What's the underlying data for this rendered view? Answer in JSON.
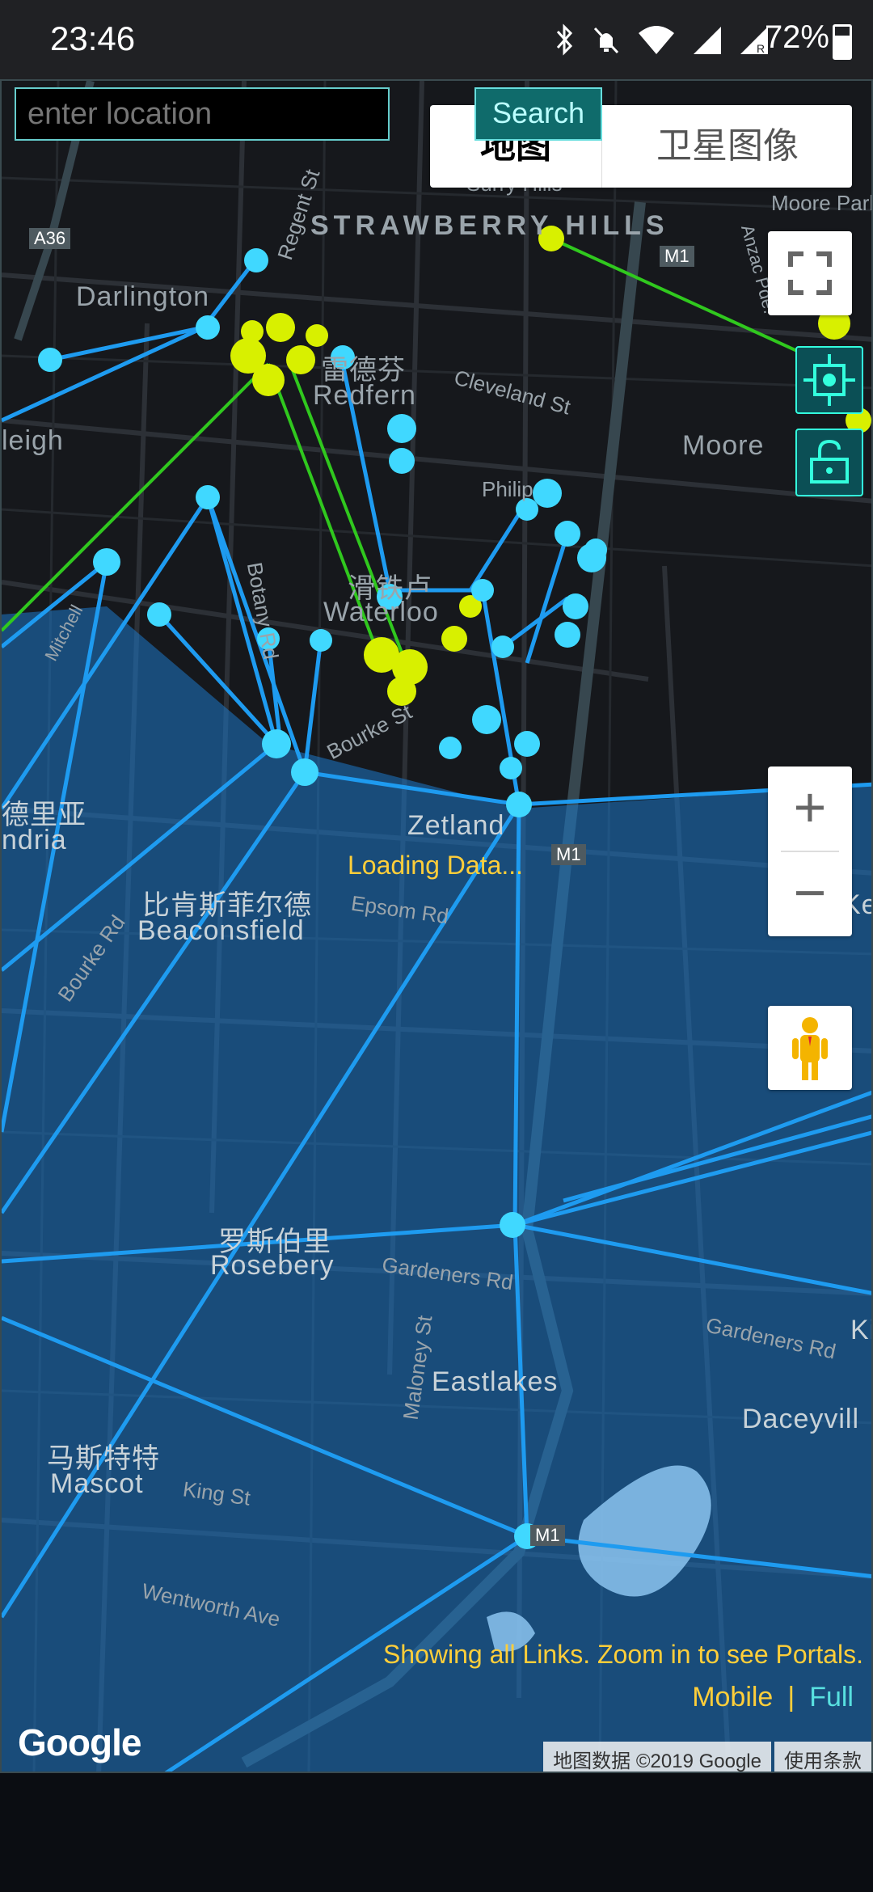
{
  "status_bar": {
    "time": "23:46",
    "battery_percent": "72%",
    "battery_level": 0.72,
    "icons": [
      "bluetooth-icon",
      "mute-icon",
      "wifi-icon",
      "signal-icon",
      "signal-roaming-icon"
    ]
  },
  "search": {
    "placeholder": "enter location",
    "button_label": "Search"
  },
  "map_type": {
    "options": [
      "地图",
      "卫星图像"
    ],
    "selected": "地图"
  },
  "map_labels": {
    "strawberry_hills": "STRAWBERRY HILLS",
    "surry_hills": "Surry Hills",
    "darlington": "Darlington",
    "redfern_zh": "雷德芬",
    "redfern": "Redfern",
    "waterloo_zh": "滑铁卢",
    "waterloo": "Waterloo",
    "moore": "Moore",
    "moore_park_rd": "Moore Park Rd",
    "anzac_pde": "Anzac Pde.",
    "anzac": "Anzac",
    "zetland": "Zetland",
    "beaconsfield_zh": "比肯斯菲尔德",
    "beaconsfield": "Beaconsfield",
    "rosebery_zh": "罗斯伯里",
    "rosebery": "Rosebery",
    "eastlakes": "Eastlakes",
    "daceyville": "Daceyvill",
    "mascot_zh": "马斯特特",
    "mascot": "Mascot",
    "cleveland_st": "Cleveland St",
    "botany_rd": "Botany Rd",
    "bourke_st": "Bourke St",
    "bourke_rd": "Bourke Rd",
    "epsom_rd": "Epsom Rd",
    "gardeners_rd": "Gardeners Rd",
    "maloney_st": "Maloney St",
    "king_st": "King St",
    "wentworth_ave": "Wentworth Ave",
    "regent_st": "Regent St",
    "mitchell": "Mitchell",
    "alexandria_zh": "德里亚",
    "alexandria": "ndria",
    "eveleigh": "leigh",
    "philip": "Philip",
    "a36": "A36",
    "m1": "M1",
    "kensington": "Ke",
    "kingsford": "Ki"
  },
  "map_controls": {
    "zoom_in": "+",
    "zoom_out": "−"
  },
  "overlay": {
    "loading": "Loading Data...",
    "showing_links": "Showing all Links. Zoom in to see Portals.",
    "mode_mobile": "Mobile",
    "mode_separator": "|",
    "mode_full": "Full"
  },
  "attribution": {
    "logo": "Google",
    "data": "地图数据 ©2019 Google",
    "terms": "使用条款"
  },
  "colors": {
    "resistance": "#1e9bf0",
    "enlightened": "#30c81e",
    "enl_portal": "#d8f000",
    "res_portal": "#40d8ff",
    "field": "#1e78c8",
    "text_accent": "#ffce3a"
  }
}
